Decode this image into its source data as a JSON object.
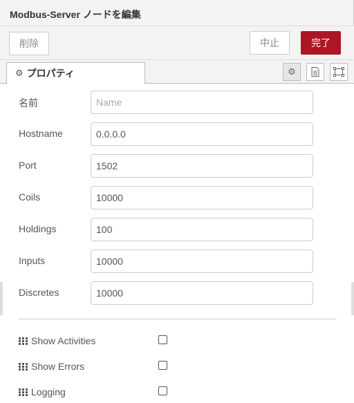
{
  "header": {
    "title": "Modbus-Server ノードを編集"
  },
  "toolbar": {
    "delete_label": "削除",
    "cancel_label": "中止",
    "done_label": "完了"
  },
  "tab": {
    "label": "プロパティ",
    "icon": "gear-icon"
  },
  "tab_buttons": [
    "gear-icon",
    "file-icon",
    "frame-icon"
  ],
  "form": {
    "name": {
      "label": "名前",
      "value": "",
      "placeholder": "Name"
    },
    "hostname": {
      "label": "Hostname",
      "value": "0.0.0.0"
    },
    "port": {
      "label": "Port",
      "value": "1502"
    },
    "coils": {
      "label": "Coils",
      "value": "10000"
    },
    "holdings": {
      "label": "Holdings",
      "value": "100"
    },
    "inputs": {
      "label": "Inputs",
      "value": "10000"
    },
    "discretes": {
      "label": "Discretes",
      "value": "10000"
    }
  },
  "options": {
    "show_activities": {
      "label": "Show Activities",
      "checked": false
    },
    "show_errors": {
      "label": "Show Errors",
      "checked": false
    },
    "logging": {
      "label": "Logging",
      "checked": false
    }
  },
  "colors": {
    "accent": "#ad1625",
    "toolbar_bg": "#f3f3f3",
    "border": "#cccccc"
  }
}
